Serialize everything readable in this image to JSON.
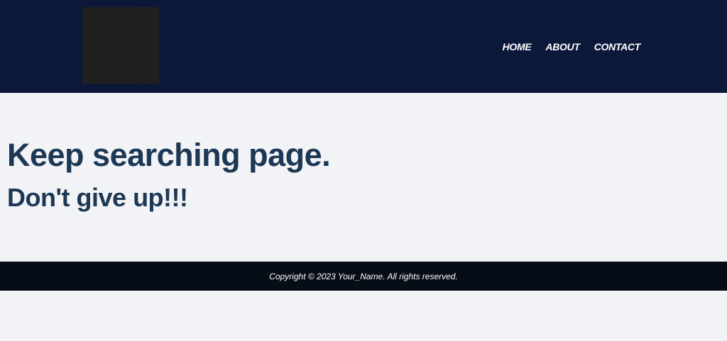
{
  "header": {
    "logo_icon": "dark-textured-square-logo",
    "background_color": "#0b1839",
    "nav": [
      {
        "label": "HOME"
      },
      {
        "label": "ABOUT"
      },
      {
        "label": "CONTACT"
      }
    ]
  },
  "main": {
    "heading": "Keep searching page.",
    "subheading": "Don't give up!!!",
    "text_color": "#1d3854"
  },
  "footer": {
    "copyright": "Copyright © 2023 Your_Name. All rights reserved.",
    "background_color": "#060d16"
  }
}
